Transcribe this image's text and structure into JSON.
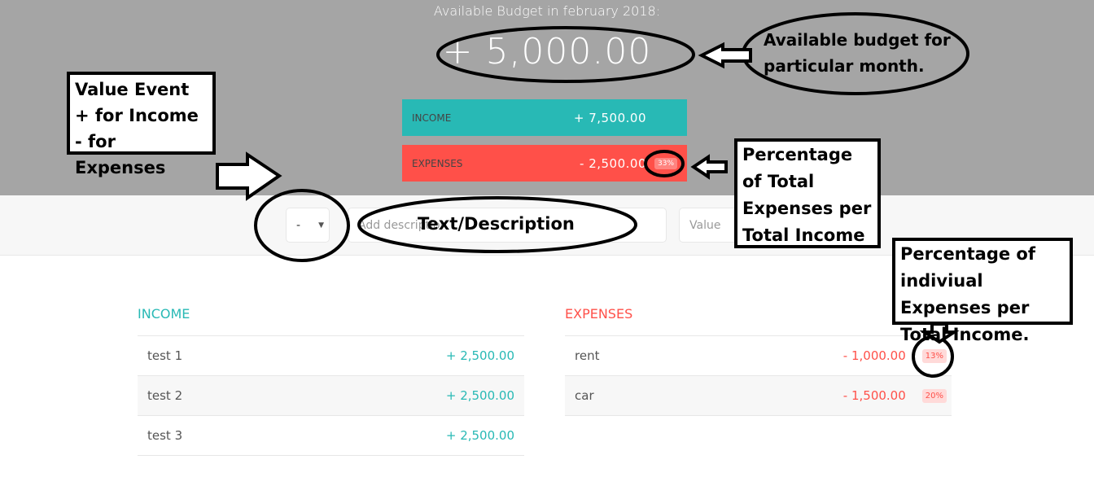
{
  "header": {
    "title": "Available Budget in february 2018:",
    "budget": "+ 5,000.00"
  },
  "summary": {
    "income_label": "INCOME",
    "income_value": "+ 7,500.00",
    "expenses_label": "EXPENSES",
    "expenses_value": "- 2,500.00",
    "expenses_percent": "33%"
  },
  "add_form": {
    "type_value": "-",
    "description_placeholder": "Add description",
    "value_placeholder": "Value"
  },
  "income": {
    "title": "INCOME",
    "items": [
      {
        "description": "test 1",
        "value": "+ 2,500.00"
      },
      {
        "description": "test 2",
        "value": "+ 2,500.00"
      },
      {
        "description": "test 3",
        "value": "+ 2,500.00"
      }
    ]
  },
  "expenses": {
    "title": "EXPENSES",
    "items": [
      {
        "description": "rent",
        "value": "- 1,000.00",
        "percent": "13%"
      },
      {
        "description": "car",
        "value": "- 1,500.00",
        "percent": "20%"
      }
    ]
  },
  "annotations": {
    "budget": "Available budget for particular month.",
    "value_event": [
      "Value Event",
      "+ for Income",
      "- for Expenses"
    ],
    "description": "Text/Description",
    "total_pct": "Percentage of Total Expenses per Total Income",
    "item_pct": "Percentage of indiviual Expenses per Total Income."
  },
  "colors": {
    "income": "#28b9b5",
    "expenses": "#ff5049",
    "header_bg": "#a5a5a5"
  }
}
